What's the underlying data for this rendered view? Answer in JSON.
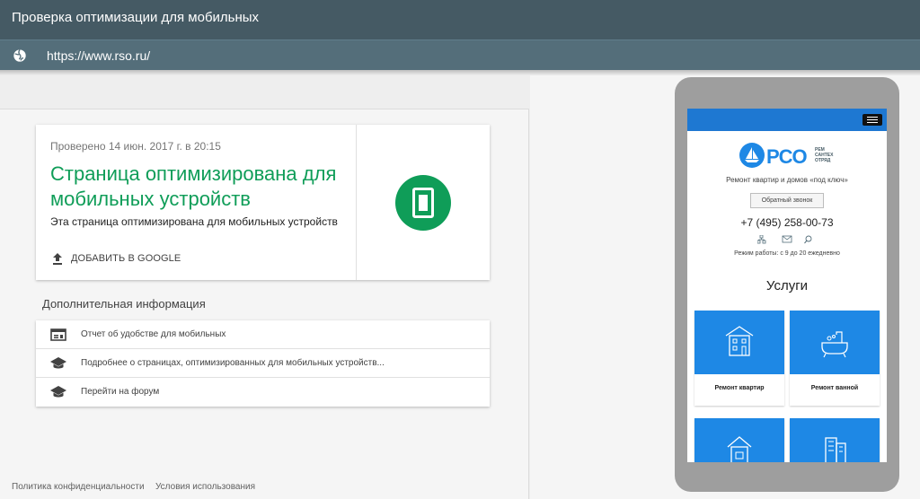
{
  "app": {
    "title": "Проверка оптимизации для мобильных"
  },
  "urlbar": {
    "url": "https://www.rso.ru/",
    "icon": "globe-icon"
  },
  "result": {
    "checked_at": "Проверено 14 июн. 2017 г. в 20:15",
    "verdict": "Страница оптимизирована для мобильных устройств",
    "subtitle": "Эта страница оптимизирована для мобильных устройств",
    "add_label": "ДОБАВИТЬ В GOOGLE",
    "accent_color": "#0f9d58"
  },
  "extra": {
    "heading": "Дополнительная информация",
    "items": [
      {
        "label": "Отчет об удобстве для мобильных",
        "icon": "report-icon"
      },
      {
        "label": "Подробнее о страницах, оптимизированных для мобильных устройств...",
        "icon": "school-icon"
      },
      {
        "label": "Перейти на форум",
        "icon": "school-icon"
      }
    ]
  },
  "footer": {
    "privacy": "Политика конфиденциальности",
    "terms": "Условия использования"
  },
  "preview": {
    "logo_text": "РСО",
    "logo_small": [
      "РЕМ",
      "САНТЕХ",
      "ОТРЯД"
    ],
    "slogan": "Ремонт квартир и домов «под ключ»",
    "callback": "Обратный звонок",
    "phone": "+7 (495) 258-00-73",
    "hours": "Режим работы: с 9 до 20 ежедневно",
    "services_title": "Услуги",
    "tiles": [
      "Ремонт квартир",
      "Ремонт ванной"
    ],
    "brand_color": "#1e88e5"
  }
}
